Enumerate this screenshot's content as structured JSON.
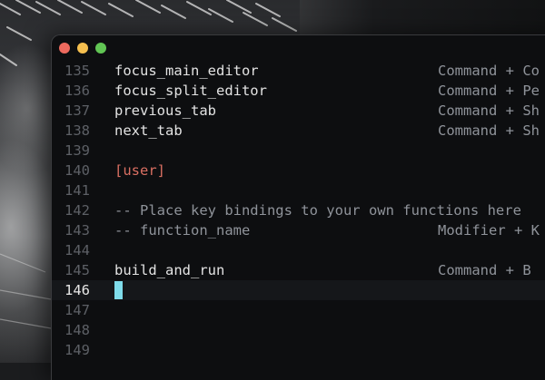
{
  "window": {
    "buttons": {
      "close": "close",
      "minimize": "minimize",
      "zoom": "zoom"
    }
  },
  "editor": {
    "current_line": "146",
    "cursor_color": "#7fdcea",
    "lines": [
      {
        "number": "135",
        "text": "focus_main_editor",
        "keys": "Command + Co",
        "kind": "code"
      },
      {
        "number": "136",
        "text": "focus_split_editor",
        "keys": "Command + Pe",
        "kind": "code"
      },
      {
        "number": "137",
        "text": "previous_tab",
        "keys": "Command + Sh",
        "kind": "code"
      },
      {
        "number": "138",
        "text": "next_tab",
        "keys": "Command + Sh",
        "kind": "code"
      },
      {
        "number": "139",
        "text": "",
        "keys": "",
        "kind": "code"
      },
      {
        "number": "140",
        "text": "[user]",
        "keys": "",
        "kind": "section"
      },
      {
        "number": "141",
        "text": "",
        "keys": "",
        "kind": "code"
      },
      {
        "number": "142",
        "text": "-- Place key bindings to your own functions here",
        "keys": "",
        "kind": "comment"
      },
      {
        "number": "143",
        "text": "-- function_name",
        "keys": "Modifier + K",
        "kind": "comment"
      },
      {
        "number": "144",
        "text": "",
        "keys": "",
        "kind": "code"
      },
      {
        "number": "145",
        "text": "build_and_run",
        "keys": "Command + B",
        "kind": "code"
      },
      {
        "number": "146",
        "text": "",
        "keys": "",
        "kind": "code"
      },
      {
        "number": "147",
        "text": "",
        "keys": "",
        "kind": "code"
      },
      {
        "number": "148",
        "text": "",
        "keys": "",
        "kind": "code"
      },
      {
        "number": "149",
        "text": "",
        "keys": "",
        "kind": "code"
      }
    ]
  }
}
